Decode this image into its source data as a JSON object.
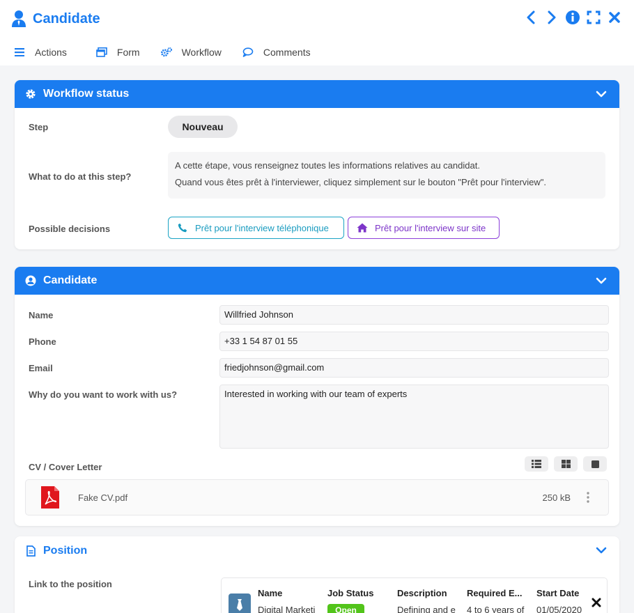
{
  "window": {
    "title": "Candidate",
    "menu": [
      {
        "label": "Actions"
      },
      {
        "label": "Form"
      },
      {
        "label": "Workflow"
      },
      {
        "label": "Comments"
      }
    ]
  },
  "workflow": {
    "title": "Workflow status",
    "step_label": "Step",
    "step_value": "Nouveau",
    "todo_label": "What to do at this step?",
    "todo_line1": "A cette étape, vous renseignez toutes les informations relatives au candidat.",
    "todo_line2": "Quand vous êtes prêt à l'interviewer, cliquez simplement sur le bouton \"Prêt pour l'interview\".",
    "decisions_label": "Possible decisions",
    "decision1": "Prêt pour l'interview téléphonique",
    "decision2": "Prêt pour l'interview sur site"
  },
  "candidate": {
    "title": "Candidate",
    "name_label": "Name",
    "name_value": "Willfried Johnson",
    "phone_label": "Phone",
    "phone_value": "+33 1 54 87 01 55",
    "email_label": "Email",
    "email_value": "friedjohnson@gmail.com",
    "why_label": "Why do you want to work with us?",
    "why_value": "Interested in working with our team of experts",
    "cv_label": "CV / Cover Letter",
    "file_name": "Fake CV.pdf",
    "file_size": "250 kB"
  },
  "position": {
    "title": "Position",
    "link_label": "Link to the position",
    "columns": [
      "Name",
      "Job Status",
      "Description",
      "Required E...",
      "Start Date"
    ],
    "row": {
      "name": "Digital Marketi",
      "status": "Open",
      "description": "Defining and e",
      "required": "4 to 6 years of",
      "start": "01/05/2020"
    }
  },
  "colors": {
    "accent": "#1a7cf0",
    "decision1": "#1aa3c4",
    "decision2": "#8b3fd9",
    "status_open": "#52c41a",
    "pdf": "#e0161d"
  }
}
